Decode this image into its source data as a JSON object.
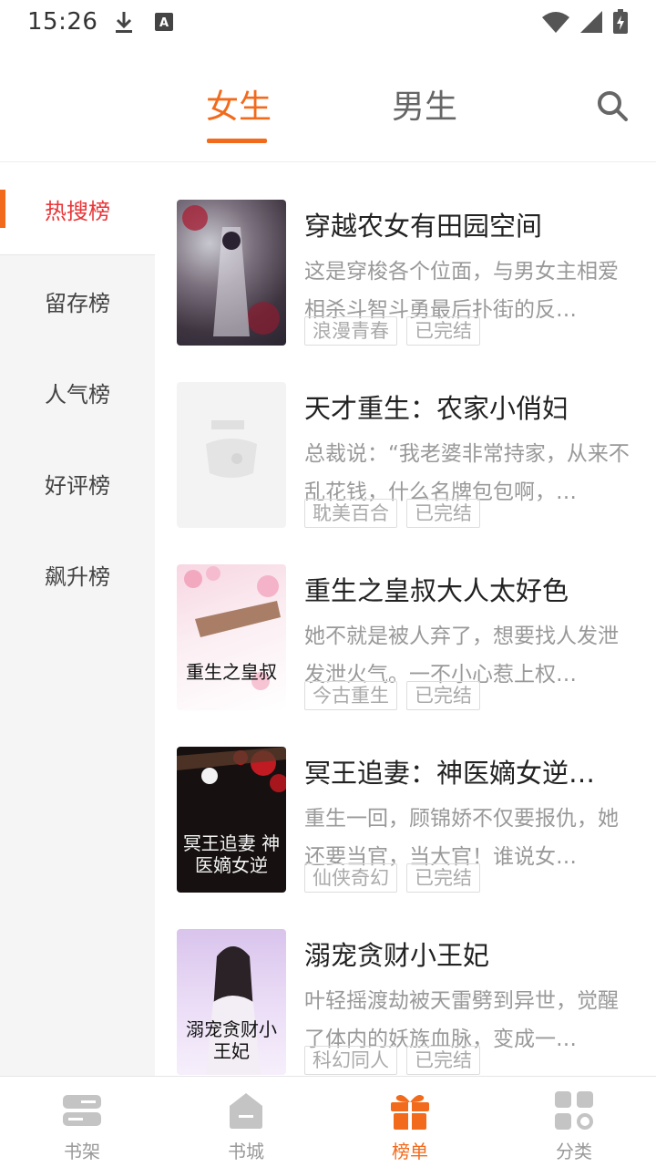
{
  "status_bar": {
    "time": "15:26"
  },
  "header": {
    "tabs": [
      {
        "label": "女生",
        "active": true
      },
      {
        "label": "男生",
        "active": false
      }
    ],
    "accent_color": "#f26a1b"
  },
  "sidebar": {
    "items": [
      {
        "label": "热搜榜",
        "active": true
      },
      {
        "label": "留存榜"
      },
      {
        "label": "人气榜"
      },
      {
        "label": "好评榜"
      },
      {
        "label": "飙升榜"
      }
    ]
  },
  "books": [
    {
      "title": "穿越农女有田园空间",
      "desc": "这是穿梭各个位面，与男女主相爱相杀斗智斗勇最后扑街的反…",
      "tags": [
        "浪漫青春",
        "已完结"
      ],
      "cover_text": ""
    },
    {
      "title": "天才重生：农家小俏妇",
      "desc": "总裁说：“我老婆非常持家，从来不乱花钱，什么名牌包包啊，…",
      "tags": [
        "耽美百合",
        "已完结"
      ],
      "cover_text": ""
    },
    {
      "title": "重生之皇叔大人太好色",
      "desc": "她不就是被人弃了，想要找人发泄发泄火气。一不小心惹上权…",
      "tags": [
        "今古重生",
        "已完结"
      ],
      "cover_text": "重生之皇叔"
    },
    {
      "title": "冥王追妻：神医嫡女逆…",
      "desc": "重生一回，顾锦娇不仅要报仇，她还要当官，当大官！谁说女…",
      "tags": [
        "仙侠奇幻",
        "已完结"
      ],
      "cover_text": "冥王追妻 神医嫡女逆"
    },
    {
      "title": "溺宠贪财小王妃",
      "desc": "叶轻摇渡劫被天雷劈到异世，觉醒了体内的妖族血脉，变成一…",
      "tags": [
        "科幻同人",
        "已完结"
      ],
      "cover_text": "溺宠贪财小王妃"
    }
  ],
  "bottom_nav": [
    {
      "label": "书架",
      "icon": "bookshelf-icon",
      "active": false
    },
    {
      "label": "书城",
      "icon": "bookstore-icon",
      "active": false
    },
    {
      "label": "榜单",
      "icon": "ranking-gift-icon",
      "active": true
    },
    {
      "label": "分类",
      "icon": "category-grid-icon",
      "active": false
    }
  ]
}
